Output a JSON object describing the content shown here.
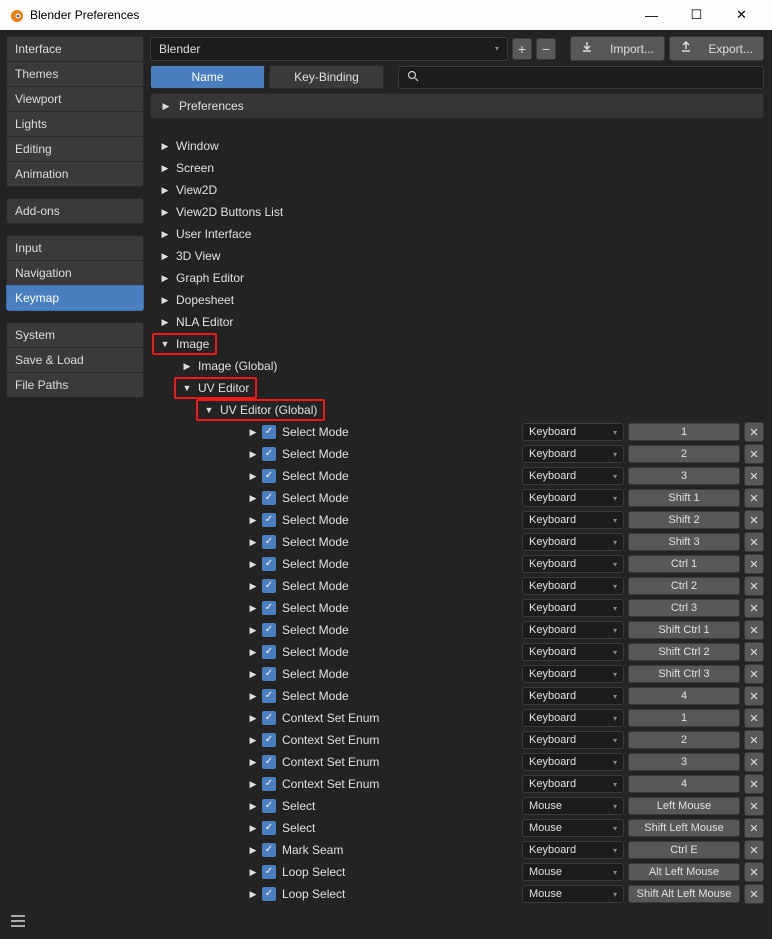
{
  "titlebar": {
    "title": "Blender Preferences"
  },
  "sidebar": {
    "groups": [
      [
        "Interface",
        "Themes",
        "Viewport",
        "Lights",
        "Editing",
        "Animation"
      ],
      [
        "Add-ons"
      ],
      [
        "Input",
        "Navigation",
        "Keymap"
      ],
      [
        "System",
        "Save & Load",
        "File Paths"
      ]
    ],
    "active": "Keymap"
  },
  "toolbar": {
    "preset": "Blender",
    "import": "Import...",
    "export": "Export..."
  },
  "tabs": {
    "name": "Name",
    "keybinding": "Key-Binding"
  },
  "prefs_label": "Preferences",
  "tree": [
    {
      "label": "Window",
      "expanded": false,
      "indent": 0
    },
    {
      "label": "Screen",
      "expanded": false,
      "indent": 0
    },
    {
      "label": "View2D",
      "expanded": false,
      "indent": 0
    },
    {
      "label": "View2D Buttons List",
      "expanded": false,
      "indent": 0
    },
    {
      "label": "User Interface",
      "expanded": false,
      "indent": 0
    },
    {
      "label": "3D View",
      "expanded": false,
      "indent": 0
    },
    {
      "label": "Graph Editor",
      "expanded": false,
      "indent": 0
    },
    {
      "label": "Dopesheet",
      "expanded": false,
      "indent": 0
    },
    {
      "label": "NLA Editor",
      "expanded": false,
      "indent": 0
    },
    {
      "label": "Image",
      "expanded": true,
      "indent": 0,
      "highlight": true
    },
    {
      "label": "Image (Global)",
      "expanded": false,
      "indent": 1
    },
    {
      "label": "UV Editor",
      "expanded": true,
      "indent": 1,
      "highlight": true
    },
    {
      "label": "UV Editor (Global)",
      "expanded": true,
      "indent": 2,
      "highlight": true
    }
  ],
  "keymap_items": [
    {
      "name": "Select Mode",
      "type": "Keyboard",
      "key": "1"
    },
    {
      "name": "Select Mode",
      "type": "Keyboard",
      "key": "2"
    },
    {
      "name": "Select Mode",
      "type": "Keyboard",
      "key": "3"
    },
    {
      "name": "Select Mode",
      "type": "Keyboard",
      "key": "Shift 1"
    },
    {
      "name": "Select Mode",
      "type": "Keyboard",
      "key": "Shift 2"
    },
    {
      "name": "Select Mode",
      "type": "Keyboard",
      "key": "Shift 3"
    },
    {
      "name": "Select Mode",
      "type": "Keyboard",
      "key": "Ctrl 1"
    },
    {
      "name": "Select Mode",
      "type": "Keyboard",
      "key": "Ctrl 2"
    },
    {
      "name": "Select Mode",
      "type": "Keyboard",
      "key": "Ctrl 3"
    },
    {
      "name": "Select Mode",
      "type": "Keyboard",
      "key": "Shift Ctrl 1"
    },
    {
      "name": "Select Mode",
      "type": "Keyboard",
      "key": "Shift Ctrl 2"
    },
    {
      "name": "Select Mode",
      "type": "Keyboard",
      "key": "Shift Ctrl 3"
    },
    {
      "name": "Select Mode",
      "type": "Keyboard",
      "key": "4"
    },
    {
      "name": "Context Set Enum",
      "type": "Keyboard",
      "key": "1"
    },
    {
      "name": "Context Set Enum",
      "type": "Keyboard",
      "key": "2"
    },
    {
      "name": "Context Set Enum",
      "type": "Keyboard",
      "key": "3"
    },
    {
      "name": "Context Set Enum",
      "type": "Keyboard",
      "key": "4"
    },
    {
      "name": "Select",
      "type": "Mouse",
      "key": "Left Mouse"
    },
    {
      "name": "Select",
      "type": "Mouse",
      "key": "Shift Left Mouse"
    },
    {
      "name": "Mark Seam",
      "type": "Keyboard",
      "key": "Ctrl E"
    },
    {
      "name": "Loop Select",
      "type": "Mouse",
      "key": "Alt Left Mouse"
    },
    {
      "name": "Loop Select",
      "type": "Mouse",
      "key": "Shift Alt Left Mouse"
    }
  ]
}
